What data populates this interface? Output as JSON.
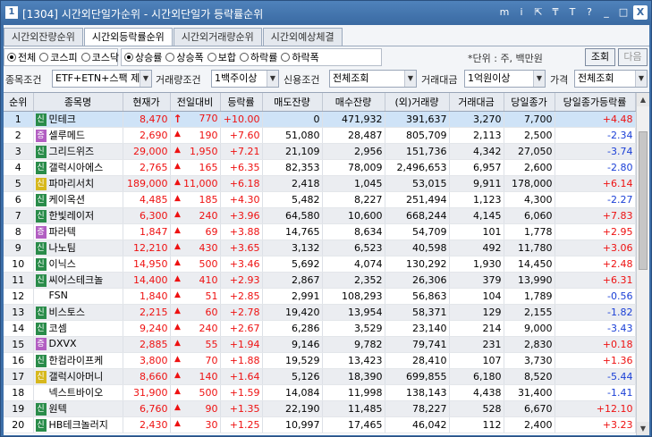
{
  "window": {
    "number": "1",
    "title": "[1304] 시간외단일가순위 - 시간외단일가 등락률순위",
    "icons": [
      "m",
      "i",
      "link",
      "pin",
      "T",
      "?",
      "minimize",
      "maximize",
      "close"
    ],
    "icon_glyphs": {
      "m": "m",
      "i": "i",
      "link": "⇱",
      "pin": "₸",
      "T": "T",
      "?": "?",
      "minimize": "_",
      "maximize": "□",
      "close": "X"
    }
  },
  "tabs": [
    {
      "label": "시간외잔량순위",
      "active": false
    },
    {
      "label": "시간외등락률순위",
      "active": true
    },
    {
      "label": "시간외거래량순위",
      "active": false
    },
    {
      "label": "시간외예상체결",
      "active": false
    }
  ],
  "market_radio": [
    {
      "label": "전체",
      "checked": true
    },
    {
      "label": "코스피",
      "checked": false
    },
    {
      "label": "코스닥",
      "checked": false
    }
  ],
  "rate_radio": [
    {
      "label": "상승률",
      "checked": true
    },
    {
      "label": "상승폭",
      "checked": false
    },
    {
      "label": "보합",
      "checked": false
    },
    {
      "label": "하락률",
      "checked": false
    },
    {
      "label": "하락폭",
      "checked": false
    }
  ],
  "unit_text": "*단위 : 주, 백만원",
  "buttons": {
    "search": "조회",
    "next": "다음"
  },
  "filters": {
    "item_label": "종목조건",
    "item_value": "ETF+ETN+스팩 제:",
    "volume_label": "거래량조건",
    "volume_value": "1백주이상",
    "credit_label": "신용조건",
    "credit_value": "전체조회",
    "amount_label": "거래대금",
    "amount_value": "1억원이상",
    "price_label": "가격",
    "price_value": "전체조회"
  },
  "columns": [
    "순위",
    "종목명",
    "현재가",
    "전일대비",
    "등락률",
    "매도잔량",
    "매수잔량",
    "(외)거래량",
    "거래대금",
    "당일종가",
    "당일종가등락률"
  ],
  "rows": [
    {
      "rank": "1",
      "badge": "신",
      "badge_color": "green",
      "name": "민테크",
      "price": "8,470",
      "arrow": "upper",
      "change": "770",
      "rate": "+10.00",
      "sell": "0",
      "buy": "471,932",
      "volume": "391,637",
      "amount": "3,270",
      "close": "7,700",
      "close_rate": "+4.48",
      "close_dir": "up"
    },
    {
      "rank": "2",
      "badge": "증",
      "badge_color": "purple",
      "name": "셀루메드",
      "price": "2,690",
      "arrow": "up",
      "change": "190",
      "rate": "+7.60",
      "sell": "51,080",
      "buy": "28,487",
      "volume": "805,709",
      "amount": "2,113",
      "close": "2,500",
      "close_rate": "-2.34",
      "close_dir": "down"
    },
    {
      "rank": "3",
      "badge": "신",
      "badge_color": "green",
      "name": "그리드위즈",
      "price": "29,000",
      "arrow": "up",
      "change": "1,950",
      "rate": "+7.21",
      "sell": "21,109",
      "buy": "2,956",
      "volume": "151,736",
      "amount": "4,342",
      "close": "27,050",
      "close_rate": "-3.74",
      "close_dir": "down"
    },
    {
      "rank": "4",
      "badge": "신",
      "badge_color": "green",
      "name": "갤럭시아에스",
      "price": "2,765",
      "arrow": "up",
      "change": "165",
      "rate": "+6.35",
      "sell": "82,353",
      "buy": "78,009",
      "volume": "2,496,653",
      "amount": "6,957",
      "close": "2,600",
      "close_rate": "-2.80",
      "close_dir": "down"
    },
    {
      "rank": "5",
      "badge": "신",
      "badge_color": "yellow",
      "name": "파마리서치",
      "price": "189,000",
      "arrow": "up",
      "change": "11,000",
      "rate": "+6.18",
      "sell": "2,418",
      "buy": "1,045",
      "volume": "53,015",
      "amount": "9,911",
      "close": "178,000",
      "close_rate": "+6.14",
      "close_dir": "up"
    },
    {
      "rank": "6",
      "badge": "신",
      "badge_color": "green",
      "name": "케이옥션",
      "price": "4,485",
      "arrow": "up",
      "change": "185",
      "rate": "+4.30",
      "sell": "5,482",
      "buy": "8,227",
      "volume": "251,494",
      "amount": "1,123",
      "close": "4,300",
      "close_rate": "-2.27",
      "close_dir": "down"
    },
    {
      "rank": "7",
      "badge": "신",
      "badge_color": "green",
      "name": "한빛레이저",
      "price": "6,300",
      "arrow": "up",
      "change": "240",
      "rate": "+3.96",
      "sell": "64,580",
      "buy": "10,600",
      "volume": "668,244",
      "amount": "4,145",
      "close": "6,060",
      "close_rate": "+7.83",
      "close_dir": "up"
    },
    {
      "rank": "8",
      "badge": "증",
      "badge_color": "purple",
      "name": "파라텍",
      "price": "1,847",
      "arrow": "up",
      "change": "69",
      "rate": "+3.88",
      "sell": "14,765",
      "buy": "8,634",
      "volume": "54,709",
      "amount": "101",
      "close": "1,778",
      "close_rate": "+2.95",
      "close_dir": "up"
    },
    {
      "rank": "9",
      "badge": "신",
      "badge_color": "green",
      "name": "나노팀",
      "price": "12,210",
      "arrow": "up",
      "change": "430",
      "rate": "+3.65",
      "sell": "3,132",
      "buy": "6,523",
      "volume": "40,598",
      "amount": "492",
      "close": "11,780",
      "close_rate": "+3.06",
      "close_dir": "up"
    },
    {
      "rank": "10",
      "badge": "신",
      "badge_color": "green",
      "name": "이닉스",
      "price": "14,950",
      "arrow": "up",
      "change": "500",
      "rate": "+3.46",
      "sell": "5,692",
      "buy": "4,074",
      "volume": "130,292",
      "amount": "1,930",
      "close": "14,450",
      "close_rate": "+2.48",
      "close_dir": "up"
    },
    {
      "rank": "11",
      "badge": "신",
      "badge_color": "green",
      "name": "씨어스테크놀",
      "price": "14,400",
      "arrow": "up",
      "change": "410",
      "rate": "+2.93",
      "sell": "2,867",
      "buy": "2,352",
      "volume": "26,306",
      "amount": "379",
      "close": "13,990",
      "close_rate": "+6.31",
      "close_dir": "up"
    },
    {
      "rank": "12",
      "badge": "",
      "badge_color": "",
      "name": "FSN",
      "price": "1,840",
      "arrow": "up",
      "change": "51",
      "rate": "+2.85",
      "sell": "2,991",
      "buy": "108,293",
      "volume": "56,863",
      "amount": "104",
      "close": "1,789",
      "close_rate": "-0.56",
      "close_dir": "down"
    },
    {
      "rank": "13",
      "badge": "신",
      "badge_color": "green",
      "name": "비스토스",
      "price": "2,215",
      "arrow": "up",
      "change": "60",
      "rate": "+2.78",
      "sell": "19,420",
      "buy": "13,954",
      "volume": "58,371",
      "amount": "129",
      "close": "2,155",
      "close_rate": "-1.82",
      "close_dir": "down"
    },
    {
      "rank": "14",
      "badge": "신",
      "badge_color": "green",
      "name": "코셈",
      "price": "9,240",
      "arrow": "up",
      "change": "240",
      "rate": "+2.67",
      "sell": "6,286",
      "buy": "3,529",
      "volume": "23,140",
      "amount": "214",
      "close": "9,000",
      "close_rate": "-3.43",
      "close_dir": "down"
    },
    {
      "rank": "15",
      "badge": "증",
      "badge_color": "purple",
      "name": "DXVX",
      "price": "2,885",
      "arrow": "up",
      "change": "55",
      "rate": "+1.94",
      "sell": "9,146",
      "buy": "9,782",
      "volume": "79,741",
      "amount": "231",
      "close": "2,830",
      "close_rate": "+0.18",
      "close_dir": "up"
    },
    {
      "rank": "16",
      "badge": "신",
      "badge_color": "green",
      "name": "한컴라이프케",
      "price": "3,800",
      "arrow": "up",
      "change": "70",
      "rate": "+1.88",
      "sell": "19,529",
      "buy": "13,423",
      "volume": "28,410",
      "amount": "107",
      "close": "3,730",
      "close_rate": "+1.36",
      "close_dir": "up"
    },
    {
      "rank": "17",
      "badge": "신",
      "badge_color": "yellow",
      "name": "갤럭시아머니",
      "price": "8,660",
      "arrow": "up",
      "change": "140",
      "rate": "+1.64",
      "sell": "5,126",
      "buy": "18,390",
      "volume": "699,855",
      "amount": "6,180",
      "close": "8,520",
      "close_rate": "-5.44",
      "close_dir": "down"
    },
    {
      "rank": "18",
      "badge": "",
      "badge_color": "",
      "name": "넥스트바이오",
      "price": "31,900",
      "arrow": "up",
      "change": "500",
      "rate": "+1.59",
      "sell": "14,084",
      "buy": "11,998",
      "volume": "138,143",
      "amount": "4,438",
      "close": "31,400",
      "close_rate": "-1.41",
      "close_dir": "down"
    },
    {
      "rank": "19",
      "badge": "신",
      "badge_color": "green",
      "name": "원텍",
      "price": "6,760",
      "arrow": "up",
      "change": "90",
      "rate": "+1.35",
      "sell": "22,190",
      "buy": "11,485",
      "volume": "78,227",
      "amount": "528",
      "close": "6,670",
      "close_rate": "+12.10",
      "close_dir": "up"
    },
    {
      "rank": "20",
      "badge": "신",
      "badge_color": "green",
      "name": "HB테크놀러지",
      "price": "2,430",
      "arrow": "up",
      "change": "30",
      "rate": "+1.25",
      "sell": "10,997",
      "buy": "17,465",
      "volume": "46,042",
      "amount": "112",
      "close": "2,400",
      "close_rate": "+3.23",
      "close_dir": "up"
    }
  ],
  "colors": {
    "up": "#e11111",
    "down": "#1a3fd6",
    "selected_row": "#cfe3f7",
    "title_bar": "#3d6fa8"
  }
}
